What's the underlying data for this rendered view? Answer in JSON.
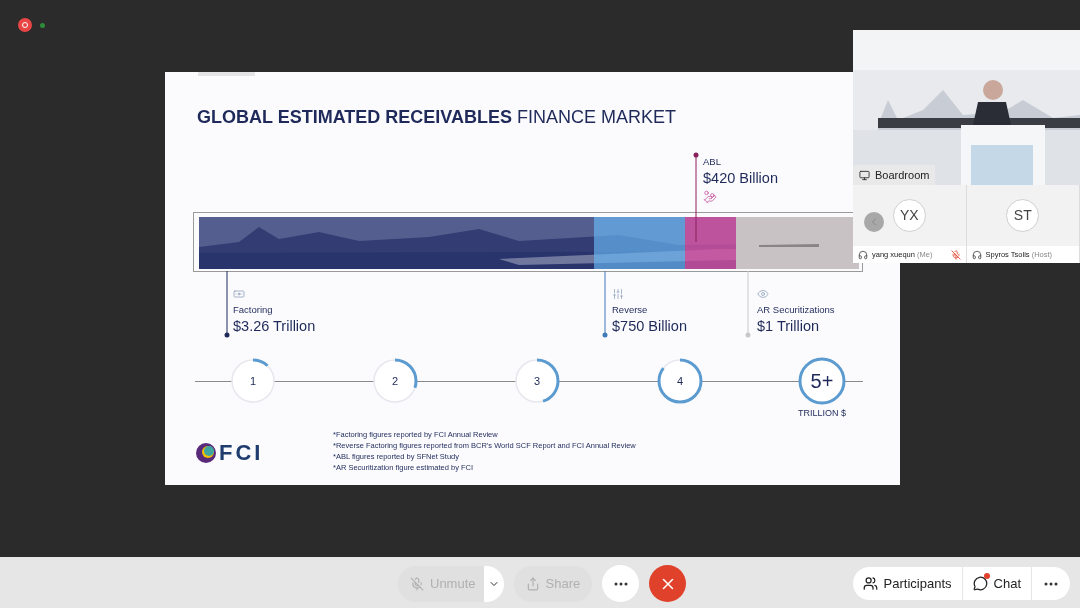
{
  "slide": {
    "title_bold": "GLOBAL ESTIMATED RECEIVABLES",
    "title_rest": "FINANCE MARKET",
    "callouts": [
      {
        "kind": "below",
        "label": "Factoring",
        "value": "$3.26 Trillion"
      },
      {
        "kind": "above",
        "label": "ABL",
        "value": "$420 Billion"
      },
      {
        "kind": "below",
        "label": "Reverse",
        "value": "$750 Billion"
      },
      {
        "kind": "below",
        "label": "AR Securitizations",
        "value": "$1 Trillion"
      }
    ],
    "steps": [
      {
        "label": "1"
      },
      {
        "label": "2"
      },
      {
        "label": "3"
      },
      {
        "label": "4"
      },
      {
        "label": "5+"
      }
    ],
    "total_caption": "TRILLION $",
    "footnotes": [
      "*Factoring figures reported by FCI Annual Review",
      "*Reverse Factoring figures reported from BCR’s World SCF Report and FCI Annual Review",
      "*ABL figures reported by SFNet Study",
      "*AR Securitization figure estimated by FCI"
    ],
    "logo_text": "FCI"
  },
  "video": {
    "room": "Boardroom"
  },
  "participants": [
    {
      "initials": "YX",
      "name": "yang xuequn",
      "tag": "(Me)",
      "muted": true
    },
    {
      "initials": "ST",
      "name": "Spyros Tsolis",
      "tag": "(Host)",
      "muted": false
    }
  ],
  "controls": {
    "unmute": {
      "label": "Unmute",
      "disabled": true
    },
    "share": {
      "label": "Share",
      "disabled": true
    },
    "participants": "Participants",
    "chat": {
      "label": "Chat",
      "unread": true
    }
  }
}
